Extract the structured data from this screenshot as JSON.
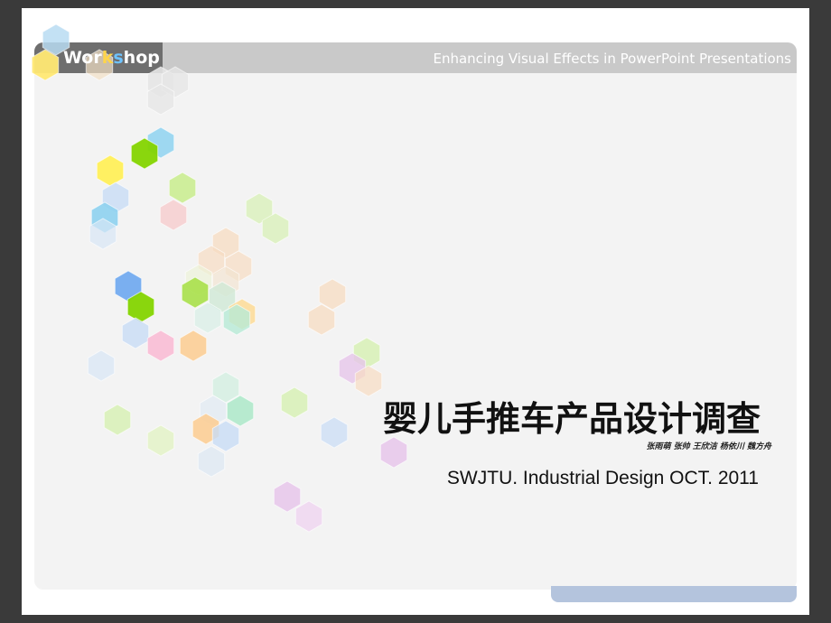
{
  "header": {
    "logo": {
      "text_a": "Wor",
      "text_b": "k",
      "text_c": "s",
      "text_d": "hop"
    },
    "tagline": "Enhancing Visual Effects in PowerPoint Presentations"
  },
  "main": {
    "title": "婴儿手推车产品设计调查",
    "authors": "张雨萌 张帅 王欣洁 杨依川 魏方舟",
    "subtitle": "SWJTU. Industrial Design OCT. 2011"
  },
  "colors": {
    "background": "#3a3a3a",
    "panel": "#f3f3f3",
    "header_bar": "#c9c9c9",
    "logo_box": "#6e6e6e",
    "footer_accent": "#b4c4dd"
  },
  "decoration": {
    "icon": "hexagon-pattern"
  }
}
